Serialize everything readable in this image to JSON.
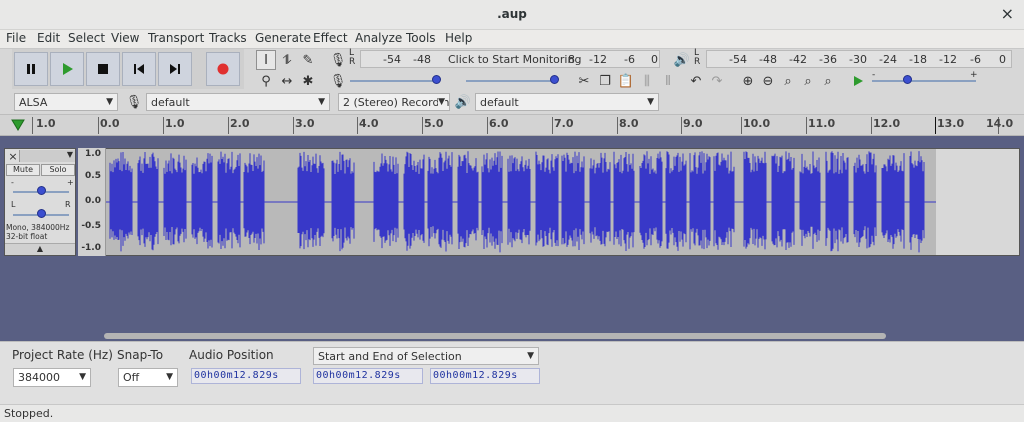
{
  "window": {
    "title": ".aup",
    "close_glyph": "×"
  },
  "menu": [
    "File",
    "Edit",
    "Select",
    "View",
    "Transport",
    "Tracks",
    "Generate",
    "Effect",
    "Analyze",
    "Tools",
    "Help"
  ],
  "transport": {
    "pause_icon": "pause-icon",
    "play_icon": "play-icon",
    "stop_icon": "stop-icon",
    "skip_start_icon": "skip-to-start-icon",
    "skip_end_icon": "skip-to-end-icon",
    "record_icon": "record-icon",
    "record_color": "#e03030",
    "play_color": "#2e9b2e"
  },
  "record_meter": {
    "lr": "L R",
    "ticks": [
      "-54",
      "-48",
      "Click to Start Monitoring",
      "8",
      "-12",
      "-6",
      "0"
    ]
  },
  "play_meter": {
    "lr": "L R",
    "ticks": [
      "-54",
      "-48",
      "-42",
      "-36",
      "-30",
      "-24",
      "-18",
      "-12",
      "-6",
      "0"
    ]
  },
  "play_speed_scale": {
    "min": "-",
    "max": "+"
  },
  "device": {
    "host": "ALSA",
    "recording_device": "default",
    "channels": "2 (Stereo) Recording",
    "playback_device": "default"
  },
  "ruler": {
    "ticks": [
      "1.0",
      "0.0",
      "1.0",
      "2.0",
      "3.0",
      "4.0",
      "5.0",
      "6.0",
      "7.0",
      "8.0",
      "9.0",
      "10.0",
      "11.0",
      "12.0",
      "13.0",
      "14.0"
    ]
  },
  "track": {
    "close": "×",
    "mute": "Mute",
    "solo": "Solo",
    "gain_min": "-",
    "gain_max": "+",
    "pan_left": "L",
    "pan_right": "R",
    "info1": "Mono, 384000Hz",
    "info2": "32-bit float",
    "collapse": "▲",
    "vruler": [
      "1.0",
      "0.5",
      "0.0",
      "-0.5",
      "-1.0"
    ],
    "wave_color": "#3838c8"
  },
  "selection_bar": {
    "project_rate_label": "Project Rate (Hz)",
    "project_rate": "384000",
    "snap_to_label": "Snap-To",
    "snap_to": "Off",
    "audio_position_label": "Audio Position",
    "audio_position": "00h00m12.829s",
    "selection_mode": "Start and End of Selection",
    "selection_start": "00h00m12.829s",
    "selection_end": "00h00m12.829s"
  },
  "status": "Stopped."
}
